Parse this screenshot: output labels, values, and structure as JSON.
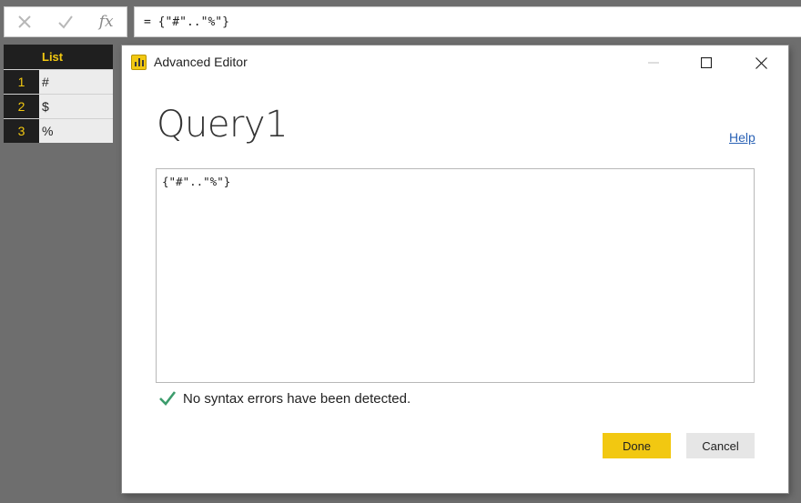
{
  "formula_bar": {
    "cancel_icon": "x-icon",
    "commit_icon": "check-icon",
    "fx_label": "fx",
    "formula": "= {\"#\"..\"%\"}"
  },
  "grid": {
    "column_header": "List",
    "rows": [
      {
        "num": "1",
        "value": "#"
      },
      {
        "num": "2",
        "value": "$"
      },
      {
        "num": "3",
        "value": "%"
      }
    ]
  },
  "dialog": {
    "title": "Advanced Editor",
    "query_name": "Query1",
    "help_label": "Help",
    "code": "{\"#\"..\"%\"}",
    "status_text": "No syntax errors have been detected.",
    "done_label": "Done",
    "cancel_label": "Cancel"
  },
  "colors": {
    "accent": "#f2c811",
    "status_check": "#3c9c6c",
    "link": "#2a62b5"
  }
}
